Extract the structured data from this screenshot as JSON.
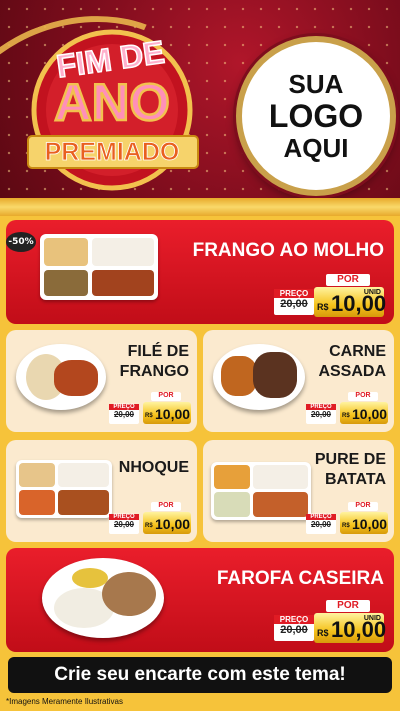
{
  "banner": {
    "line1": "FIM DE",
    "line2": "ANO",
    "line3": "PREMIADO",
    "logo_line1": "SUA",
    "logo_line2": "LOGO",
    "logo_line3": "AQUI"
  },
  "discount_badge": "-50%",
  "price_labels": {
    "de": "PREÇO",
    "por": "POR",
    "unid": "UNID",
    "currency": "R$"
  },
  "items": [
    {
      "name_l1": "FRANGO AO MOLHO",
      "name_l2": "",
      "old_price": "20,00",
      "price": "10,00"
    },
    {
      "name_l1": "FILÉ DE",
      "name_l2": "FRANGO",
      "old_price": "20,00",
      "price": "10,00"
    },
    {
      "name_l1": "CARNE",
      "name_l2": "ASSADA",
      "old_price": "20,00",
      "price": "10,00"
    },
    {
      "name_l1": "NHOQUE",
      "name_l2": "",
      "old_price": "20,00",
      "price": "10,00"
    },
    {
      "name_l1": "PURE DE",
      "name_l2": "BATATA",
      "old_price": "20,00",
      "price": "10,00"
    },
    {
      "name_l1": "FAROFA CASEIRA",
      "name_l2": "",
      "old_price": "20,00",
      "price": "10,00"
    }
  ],
  "cta": "Crie seu encarte com este tema!",
  "footnote": "*Imagens Meramente Ilustrativas",
  "colors": {
    "red": "#e01b24",
    "gold": "#f5c21b",
    "dark_red": "#7e0d1d",
    "cream": "#fbeacf"
  }
}
